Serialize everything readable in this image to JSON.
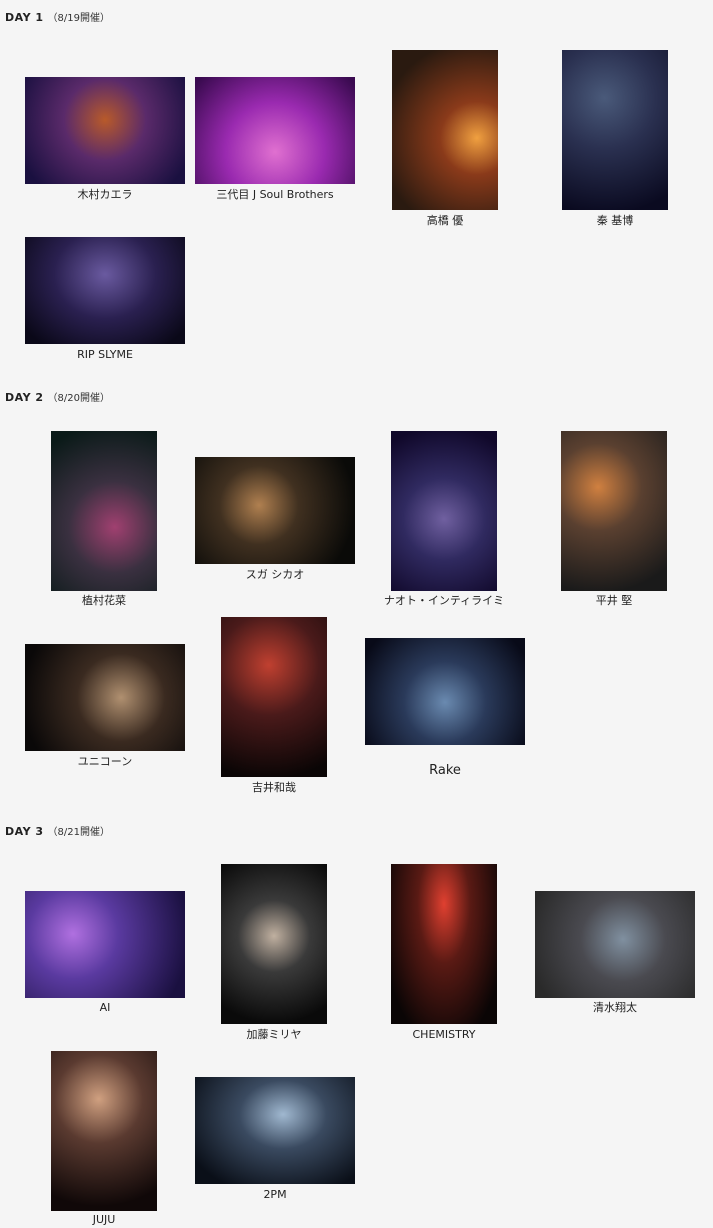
{
  "days": [
    {
      "label": "DAY 1",
      "date": "（8/19開催）"
    },
    {
      "label": "DAY 2",
      "date": "（8/20開催）"
    },
    {
      "label": "DAY 3",
      "date": "（8/21開催）"
    }
  ],
  "artists": {
    "kimura_kaela": "木村カエラ",
    "sandaime": "三代目 J Soul Brothers",
    "takahashi_yu": "高橋 優",
    "hata_motohiro": "秦 基博",
    "rip_slyme": "RIP SLYME",
    "uemura_kana": "植村花菜",
    "suga_shikao": "スガ シカオ",
    "naoto_inti": "ナオト・インティライミ",
    "hirai_ken": "平井 堅",
    "unicorn": "ユニコーン",
    "yoshii_kazuya": "吉井和哉",
    "rake": "Rake",
    "ai": "AI",
    "kato_miliyah": "加藤ミリヤ",
    "chemistry": "CHEMISTRY",
    "shimizu_shota": "清水翔太",
    "juju": "JUJU",
    "twopm": "2PM"
  },
  "colors": {
    "page_bg": "#f5f5f5",
    "text": "#222222"
  }
}
